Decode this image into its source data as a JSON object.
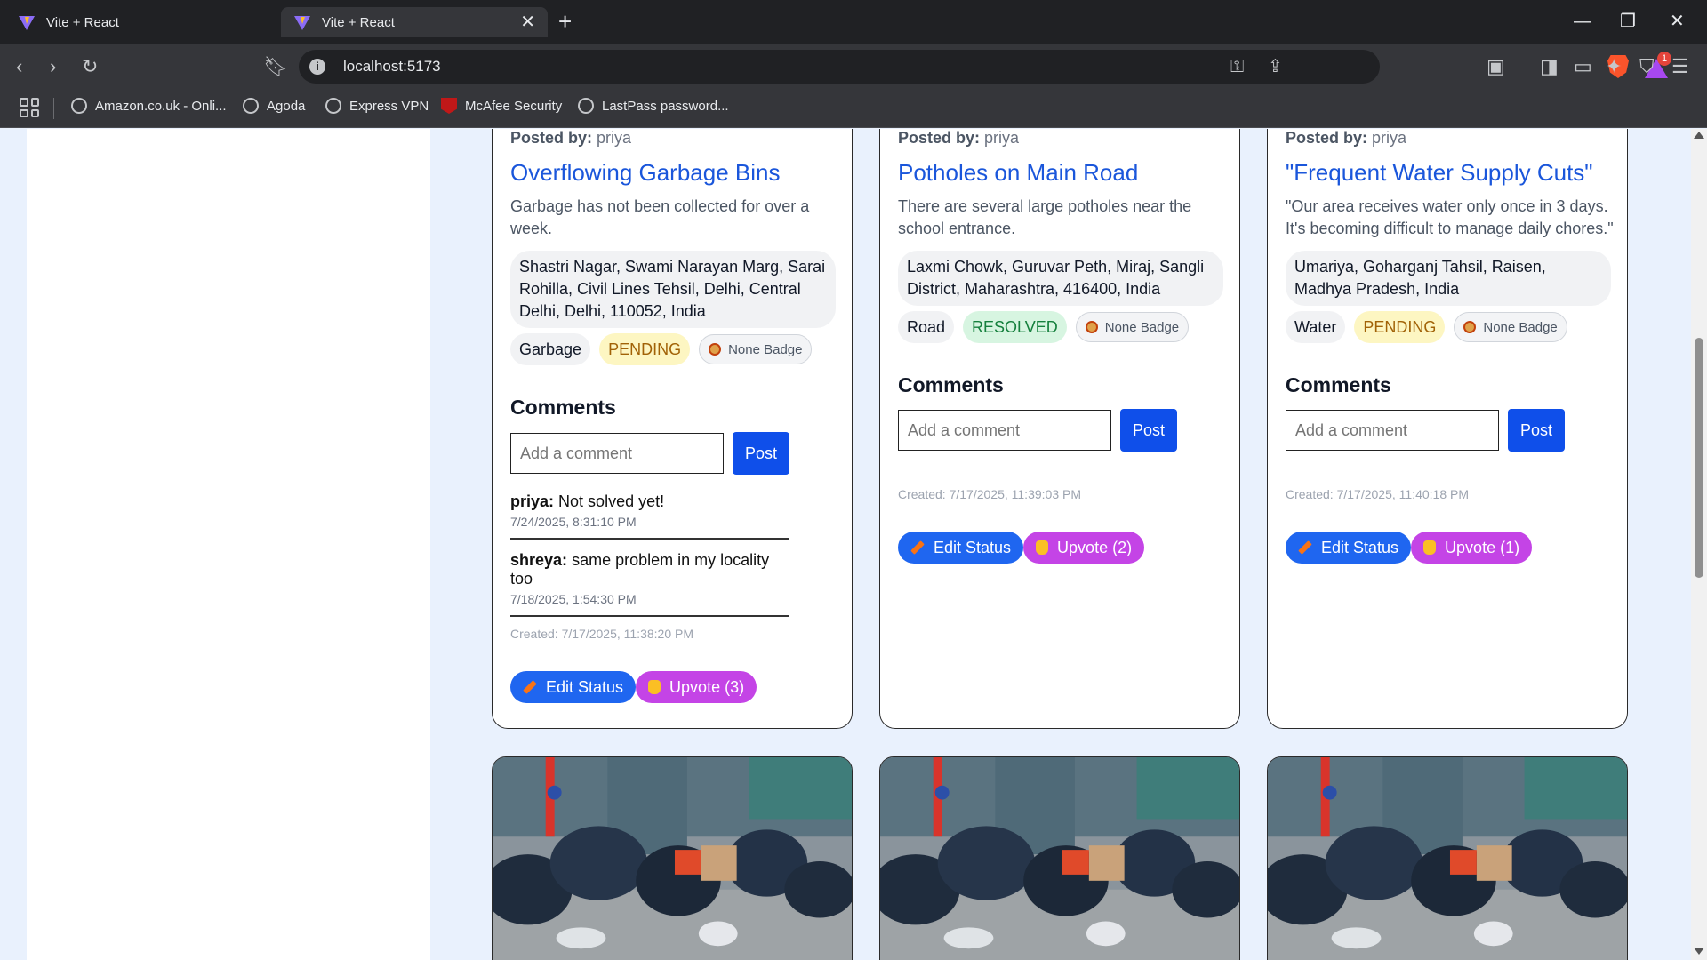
{
  "browser": {
    "tabs": [
      {
        "title": "Vite + React",
        "active": false
      },
      {
        "title": "Vite + React",
        "active": true
      }
    ],
    "url": "localhost:5173",
    "rewards_count": "1",
    "bookmarks": [
      {
        "label": "Amazon.co.uk - Onli...",
        "icon": "globe-icon"
      },
      {
        "label": "Agoda",
        "icon": "globe-icon"
      },
      {
        "label": "Express VPN",
        "icon": "globe-icon"
      },
      {
        "label": "McAfee Security",
        "icon": "mcafee-icon"
      },
      {
        "label": "LastPass password...",
        "icon": "globe-icon"
      }
    ]
  },
  "issues": [
    {
      "posted_label": "Posted by:",
      "author": "priya",
      "title": "Overflowing Garbage Bins",
      "description": "Garbage has not been collected for over a week.",
      "address": "Shastri Nagar, Swami Narayan Marg, Sarai Rohilla, Civil Lines Tehsil, Delhi, Central Delhi, Delhi, 110052, India",
      "category": "Garbage",
      "status": "PENDING",
      "badge": "None Badge",
      "comments_heading": "Comments",
      "comment_placeholder": "Add a comment",
      "post_label": "Post",
      "comments": [
        {
          "user": "priya:",
          "text": "Not solved yet!",
          "date": "7/24/2025, 8:31:10 PM"
        },
        {
          "user": "shreya:",
          "text": "same problem in my locality too",
          "date": "7/18/2025, 1:54:30 PM"
        }
      ],
      "created": "Created: 7/17/2025, 11:38:20 PM",
      "edit_label": "Edit Status",
      "upvote_label": "Upvote (3)",
      "upvotes": 3
    },
    {
      "posted_label": "Posted by:",
      "author": "priya",
      "title": "Potholes on Main Road",
      "description": "There are several large potholes near the school entrance.",
      "address": "Laxmi Chowk, Guruvar Peth, Miraj, Sangli District, Maharashtra, 416400, India",
      "category": "Road",
      "status": "RESOLVED",
      "badge": "None Badge",
      "comments_heading": "Comments",
      "comment_placeholder": "Add a comment",
      "post_label": "Post",
      "comments": [],
      "created": "Created: 7/17/2025, 11:39:03 PM",
      "edit_label": "Edit Status",
      "upvote_label": "Upvote (2)",
      "upvotes": 2
    },
    {
      "posted_label": "Posted by:",
      "author": "priya",
      "title": "\"Frequent Water Supply Cuts\"",
      "description": "\"Our area receives water only once in 3 days. It's becoming difficult to manage daily chores.\"",
      "address": "Umariya, Goharganj Tahsil, Raisen, Madhya Pradesh, India",
      "category": "Water",
      "status": "PENDING",
      "badge": "None Badge",
      "comments_heading": "Comments",
      "comment_placeholder": "Add a comment",
      "post_label": "Post",
      "comments": [],
      "created": "Created: 7/17/2025, 11:40:18 PM",
      "edit_label": "Edit Status",
      "upvote_label": "Upvote (1)",
      "upvotes": 1
    }
  ],
  "colors": {
    "title": "#1a56db",
    "post_button": "#0f4fea",
    "edit_button": "#1f66f0",
    "upvote_button": "#c444e6",
    "pending": "#fdf6c2",
    "resolved": "#d7f5e1",
    "page_bg": "#e9f1fd"
  },
  "images": [
    {
      "alt": "garbage-photo"
    },
    {
      "alt": "garbage-photo"
    },
    {
      "alt": "garbage-photo"
    }
  ]
}
